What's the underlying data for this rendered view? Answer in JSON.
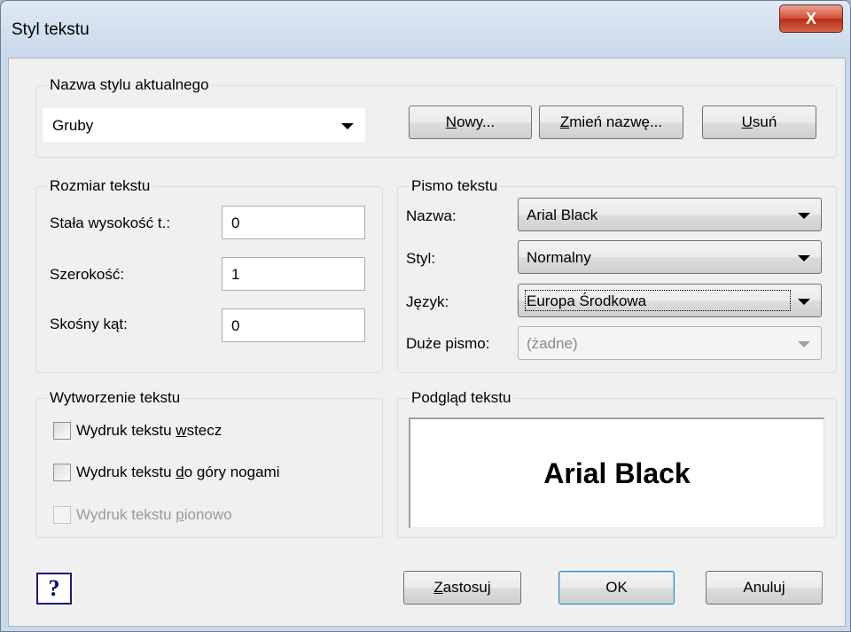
{
  "window": {
    "title": "Styl tekstu",
    "close_label": "X"
  },
  "current_style": {
    "group_label": "Nazwa stylu aktualnego",
    "value": "Gruby",
    "buttons": {
      "new": "Nowy...",
      "rename": "Zmień nazwę...",
      "delete": "Usuń"
    }
  },
  "size": {
    "group_label": "Rozmiar tekstu",
    "height_label": "Stała wysokość t.:",
    "height_value": "0",
    "width_label": "Szerokość:",
    "width_value": "1",
    "oblique_label": "Skośny kąt:",
    "oblique_value": "0"
  },
  "font": {
    "group_label": "Pismo tekstu",
    "name_label": "Nazwa:",
    "name_value": "Arial Black",
    "style_label": "Styl:",
    "style_value": "Normalny",
    "language_label": "Język:",
    "language_value": "Europa Środkowa",
    "bigfont_label": "Duże pismo:",
    "bigfont_value": "(żadne)"
  },
  "generation": {
    "group_label": "Wytworzenie tekstu",
    "backwards": {
      "label": "Wydruk tekstu wstecz",
      "checked": false
    },
    "upside_down": {
      "label": "Wydruk tekstu do góry nogami",
      "checked": false
    },
    "vertical": {
      "label": "Wydruk tekstu pionowo",
      "checked": false,
      "disabled": true
    }
  },
  "preview": {
    "group_label": "Podgląd tekstu",
    "sample": "Arial Black"
  },
  "footer": {
    "help": "?",
    "apply": "Zastosuj",
    "ok": "OK",
    "cancel": "Anuluj"
  }
}
